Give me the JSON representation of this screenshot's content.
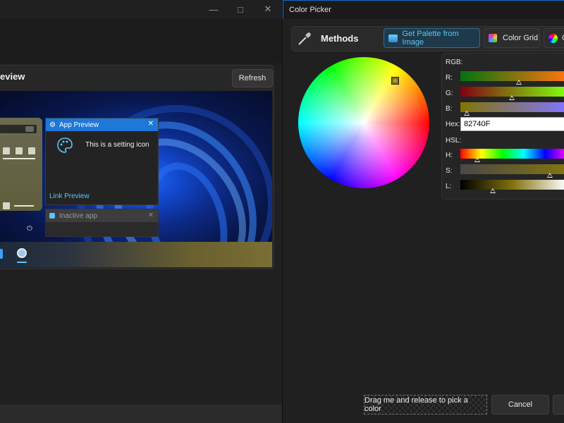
{
  "left_window": {
    "preview_title": "eview",
    "refresh_label": "Refresh",
    "app_preview": {
      "title": "App Preview",
      "setting_text": "This is a setting icon",
      "link": "Link Preview"
    },
    "inactive_app": {
      "title": "Inactive app"
    },
    "controls": [
      "minimize-icon",
      "maximize-icon",
      "close-icon"
    ]
  },
  "color_picker": {
    "title": "Color Picker",
    "methods_label": "Methods",
    "method_buttons": [
      {
        "label": "Get Palette from Image",
        "icon": "image-icon",
        "active": true
      },
      {
        "label": "Color Grid",
        "icon": "color-grid-icon",
        "active": false
      },
      {
        "label": "C",
        "icon": "color-wheel-icon",
        "active": false
      }
    ],
    "rgb_label": "RGB:",
    "r_label": "R:",
    "g_label": "G:",
    "b_label": "B:",
    "hex_label": "Hex:",
    "hex_value": "82740F",
    "hsl_label": "HSL:",
    "h_label": "H:",
    "s_label": "S:",
    "l_label": "L:",
    "drag_label": "Drag me and release to pick a color",
    "cancel_label": "Cancel",
    "selected_color": "#82740F"
  }
}
